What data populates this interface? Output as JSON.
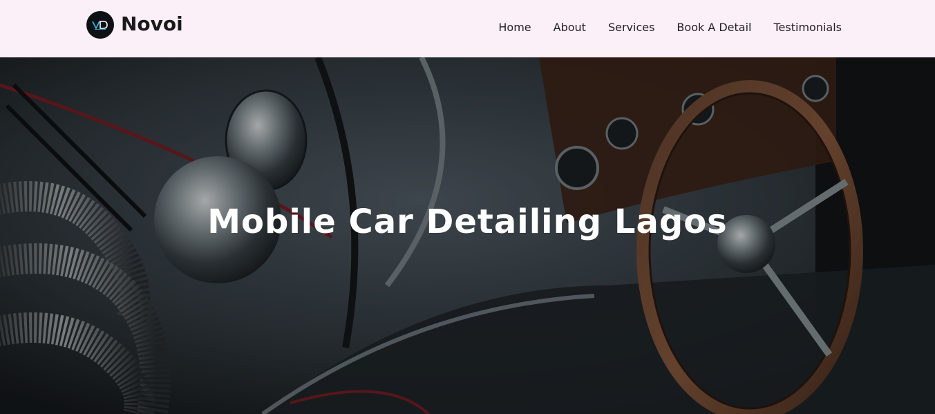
{
  "brand": {
    "name": "Novoi",
    "logo_text": "VD",
    "accent": "#2fb5e6"
  },
  "nav": {
    "items": [
      {
        "label": "Home"
      },
      {
        "label": "About"
      },
      {
        "label": "Services"
      },
      {
        "label": "Book A Detail"
      },
      {
        "label": "Testimonials"
      }
    ]
  },
  "hero": {
    "title": "Mobile Car Detailing Lagos",
    "background": "classic-car-dashboard-photo"
  },
  "colors": {
    "navbar_bg": "#fbeff8",
    "text_dark": "#222222",
    "hero_text": "#ffffff"
  }
}
